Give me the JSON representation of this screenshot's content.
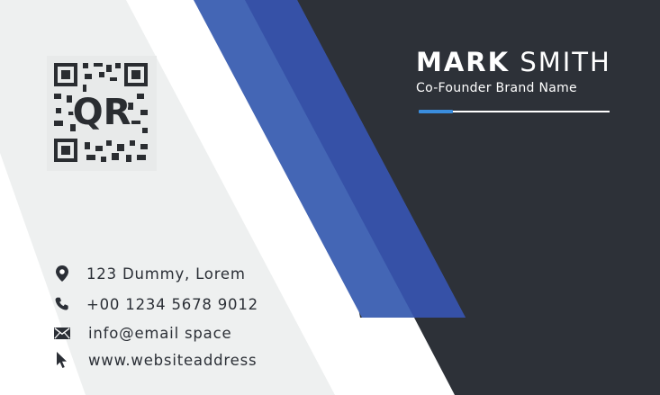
{
  "card": {
    "qr_label": "QR",
    "name_first": "MARK",
    "name_last": "SMITH",
    "job_title": "Co-Founder Brand Name",
    "colors": {
      "dark_panel": "#2d3138",
      "blue_stripe": "#3f5fae",
      "blue_stripe_deep": "#3551a6",
      "light_panel": "#eef0f0",
      "accent_line": "#3a8dde",
      "text_dark": "#2b2f36"
    }
  },
  "contacts": [
    {
      "icon": "location-pin-icon",
      "text": "123 Dummy, Lorem"
    },
    {
      "icon": "phone-icon",
      "text": "+00 1234 5678 9012"
    },
    {
      "icon": "envelope-icon",
      "text": "info@email space"
    },
    {
      "icon": "cursor-arrow-icon",
      "text": "www.websiteaddress"
    }
  ]
}
